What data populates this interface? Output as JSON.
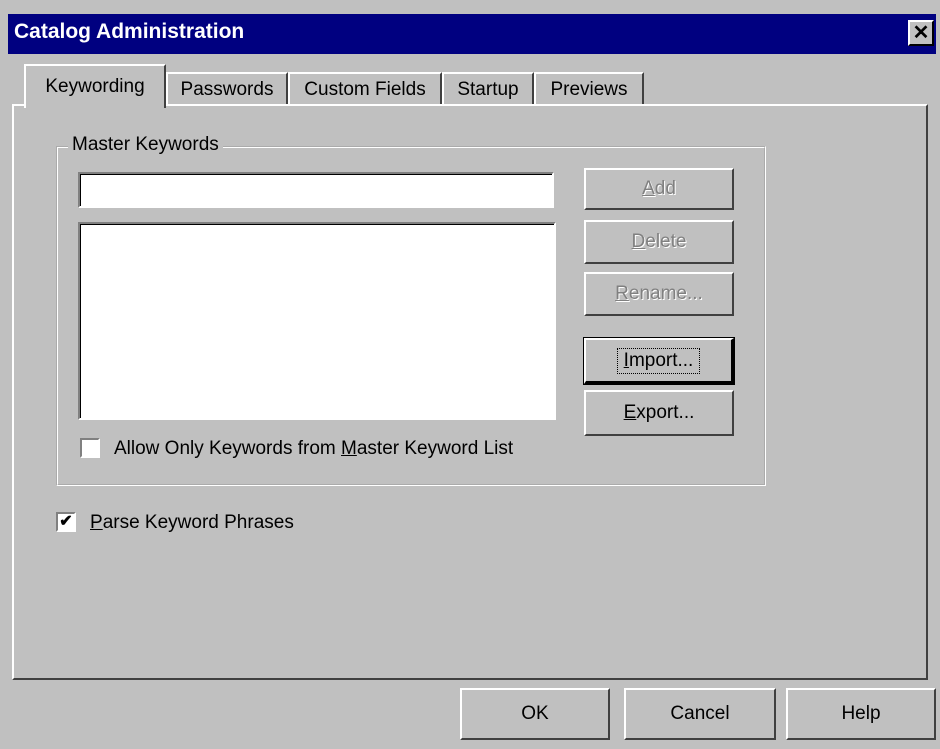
{
  "window": {
    "title": "Catalog Administration",
    "close_glyph": "✕"
  },
  "tabs": [
    {
      "label": "Keywording",
      "active": true
    },
    {
      "label": "Passwords",
      "active": false
    },
    {
      "label": "Custom Fields",
      "active": false
    },
    {
      "label": "Startup",
      "active": false
    },
    {
      "label": "Previews",
      "active": false
    }
  ],
  "master_keywords": {
    "group_label": "Master Keywords",
    "input_value": "",
    "list_items": [],
    "buttons": {
      "add": {
        "label_pre": "",
        "label_ul": "A",
        "label_post": "dd",
        "enabled": false
      },
      "delete": {
        "label_pre": "",
        "label_ul": "D",
        "label_post": "elete",
        "enabled": false
      },
      "rename": {
        "label_pre": "",
        "label_ul": "R",
        "label_post": "ename...",
        "enabled": false
      },
      "import": {
        "label_pre": "",
        "label_ul": "I",
        "label_post": "mport...",
        "enabled": true,
        "focused": true
      },
      "export": {
        "label_pre": "",
        "label_ul": "E",
        "label_post": "xport...",
        "enabled": true
      }
    },
    "allow_only_checkbox": {
      "label_pre": "Allow Only Keywords from ",
      "label_ul": "M",
      "label_post": "aster Keyword List",
      "checked": false
    }
  },
  "parse_checkbox": {
    "label_pre": "",
    "label_ul": "P",
    "label_post": "arse Keyword Phrases",
    "checked": true,
    "check_glyph": "✔"
  },
  "footer_buttons": {
    "ok": "OK",
    "cancel": "Cancel",
    "help": "Help"
  },
  "colors": {
    "titlebar": "#000080",
    "face": "#c0c0c0",
    "disabled_text": "#808080"
  },
  "icons": {
    "close": "close-icon",
    "check": "checkmark-icon"
  }
}
